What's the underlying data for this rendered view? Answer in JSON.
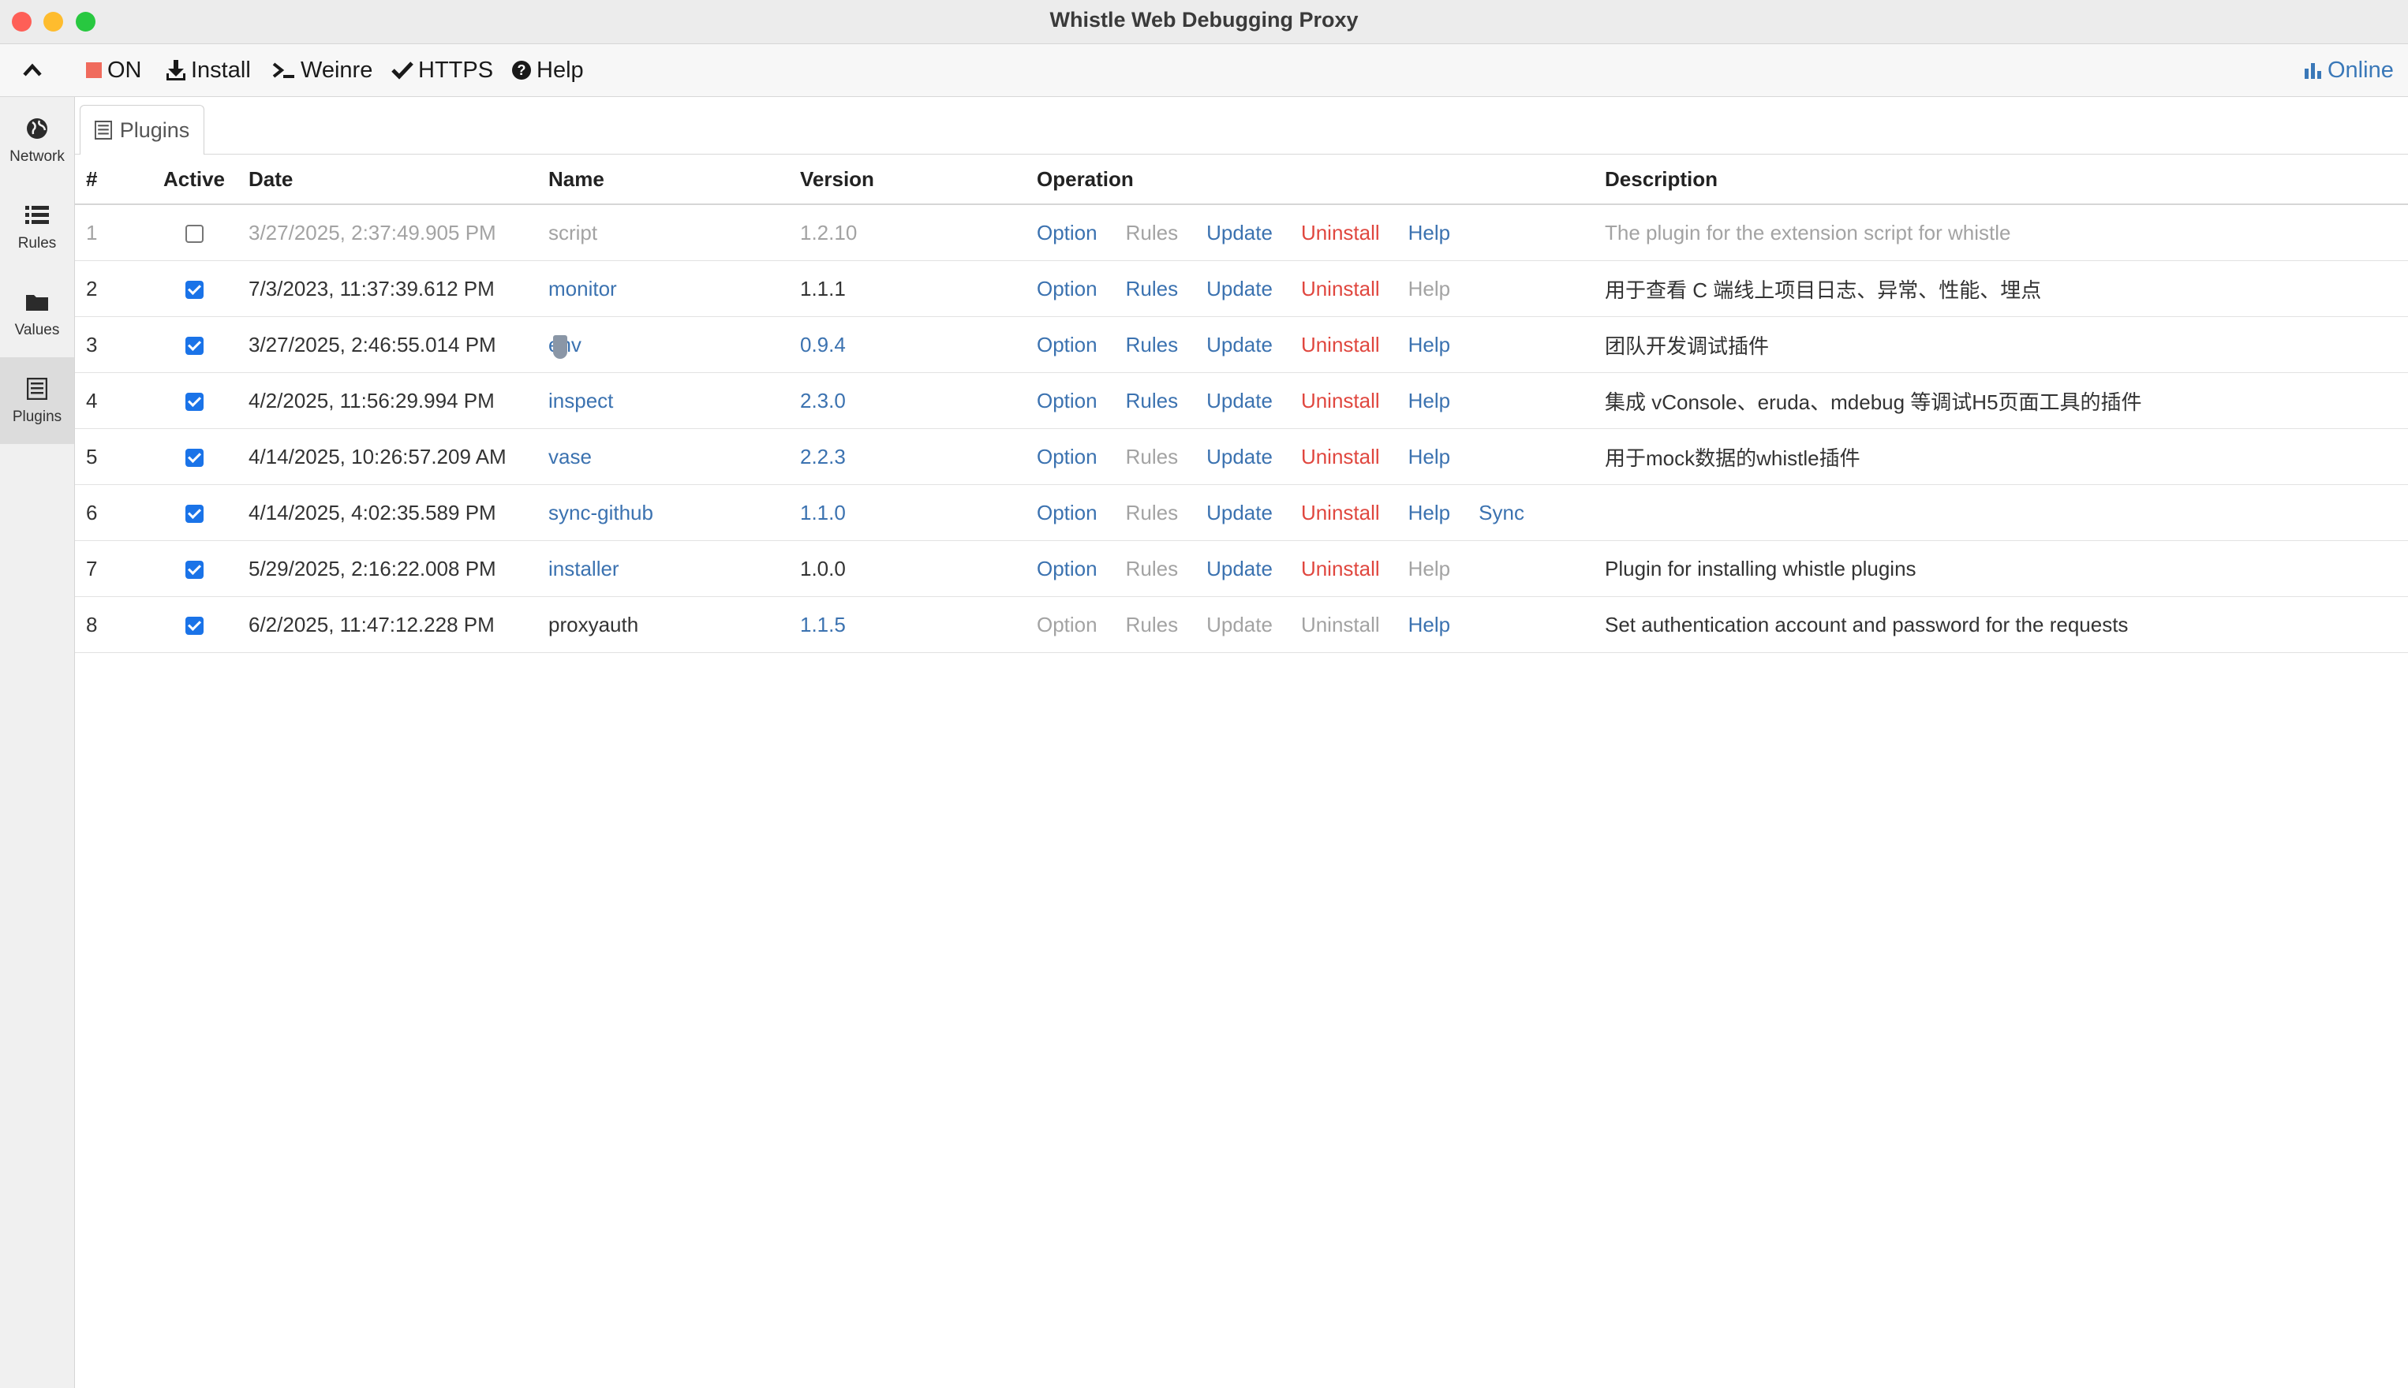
{
  "window": {
    "title": "Whistle Web Debugging Proxy"
  },
  "menubar": {
    "collapse_icon": "chevron-up-icon",
    "items": [
      {
        "label": "ON",
        "icon": "stop-square-icon",
        "color": "#f06b5d"
      },
      {
        "label": "Install",
        "icon": "download-icon"
      },
      {
        "label": "Weinre",
        "icon": "terminal-icon"
      },
      {
        "label": "HTTPS",
        "icon": "check-icon"
      },
      {
        "label": "Help",
        "icon": "question-circle-icon"
      }
    ],
    "online": {
      "label": "Online",
      "icon": "bar-chart-icon",
      "color": "#3a78b8"
    }
  },
  "sidebar": {
    "items": [
      {
        "label": "Network",
        "icon": "globe-icon",
        "active": false
      },
      {
        "label": "Rules",
        "icon": "list-icon",
        "active": false
      },
      {
        "label": "Values",
        "icon": "folder-icon",
        "active": false
      },
      {
        "label": "Plugins",
        "icon": "plugins-list-icon",
        "active": true
      }
    ]
  },
  "tab": {
    "label": "Plugins",
    "icon": "plugins-list-icon"
  },
  "table": {
    "headers": [
      "#",
      "Active",
      "Date",
      "Name",
      "Version",
      "Operation",
      "Description"
    ],
    "rows": [
      {
        "num": "1",
        "active": false,
        "disabled": true,
        "date": "3/27/2025, 2:37:49.905 PM",
        "name": "script",
        "name_link": false,
        "version": "1.2.10",
        "version_link": false,
        "ops": [
          {
            "label": "Option",
            "style": "link"
          },
          {
            "label": "Rules",
            "style": "dim"
          },
          {
            "label": "Update",
            "style": "link"
          },
          {
            "label": "Uninstall",
            "style": "red"
          },
          {
            "label": "Help",
            "style": "link"
          }
        ],
        "description": "The plugin for the extension script for whistle"
      },
      {
        "num": "2",
        "active": true,
        "disabled": false,
        "date": "7/3/2023, 11:37:39.612 PM",
        "name": "monitor",
        "name_link": true,
        "version": "1.1.1",
        "version_link": false,
        "ops": [
          {
            "label": "Option",
            "style": "link"
          },
          {
            "label": "Rules",
            "style": "link"
          },
          {
            "label": "Update",
            "style": "link"
          },
          {
            "label": "Uninstall",
            "style": "red"
          },
          {
            "label": "Help",
            "style": "dim"
          }
        ],
        "description": "用于查看 C 端线上项目日志、异常、性能、埋点"
      },
      {
        "num": "3",
        "active": true,
        "disabled": false,
        "date": "3/27/2025, 2:46:55.014 PM",
        "name": "env",
        "name_link": true,
        "version": "0.9.4",
        "version_link": true,
        "ops": [
          {
            "label": "Option",
            "style": "link"
          },
          {
            "label": "Rules",
            "style": "link"
          },
          {
            "label": "Update",
            "style": "link"
          },
          {
            "label": "Uninstall",
            "style": "red"
          },
          {
            "label": "Help",
            "style": "link"
          }
        ],
        "description": "团队开发调试插件"
      },
      {
        "num": "4",
        "active": true,
        "disabled": false,
        "date": "4/2/2025, 11:56:29.994 PM",
        "name": "inspect",
        "name_link": true,
        "version": "2.3.0",
        "version_link": true,
        "ops": [
          {
            "label": "Option",
            "style": "link"
          },
          {
            "label": "Rules",
            "style": "link"
          },
          {
            "label": "Update",
            "style": "link"
          },
          {
            "label": "Uninstall",
            "style": "red"
          },
          {
            "label": "Help",
            "style": "link"
          }
        ],
        "description": "集成 vConsole、eruda、mdebug 等调试H5页面工具的插件"
      },
      {
        "num": "5",
        "active": true,
        "disabled": false,
        "date": "4/14/2025, 10:26:57.209 AM",
        "name": "vase",
        "name_link": true,
        "version": "2.2.3",
        "version_link": true,
        "ops": [
          {
            "label": "Option",
            "style": "link"
          },
          {
            "label": "Rules",
            "style": "dim"
          },
          {
            "label": "Update",
            "style": "link"
          },
          {
            "label": "Uninstall",
            "style": "red"
          },
          {
            "label": "Help",
            "style": "link"
          }
        ],
        "description": "用于mock数据的whistle插件"
      },
      {
        "num": "6",
        "active": true,
        "disabled": false,
        "date": "4/14/2025, 4:02:35.589 PM",
        "name": "sync-github",
        "name_link": true,
        "version": "1.1.0",
        "version_link": true,
        "ops": [
          {
            "label": "Option",
            "style": "link"
          },
          {
            "label": "Rules",
            "style": "dim"
          },
          {
            "label": "Update",
            "style": "link"
          },
          {
            "label": "Uninstall",
            "style": "red"
          },
          {
            "label": "Help",
            "style": "link"
          },
          {
            "label": "Sync",
            "style": "link"
          }
        ],
        "description": ""
      },
      {
        "num": "7",
        "active": true,
        "disabled": false,
        "date": "5/29/2025, 2:16:22.008 PM",
        "name": "installer",
        "name_link": true,
        "version": "1.0.0",
        "version_link": false,
        "ops": [
          {
            "label": "Option",
            "style": "link"
          },
          {
            "label": "Rules",
            "style": "dim"
          },
          {
            "label": "Update",
            "style": "link"
          },
          {
            "label": "Uninstall",
            "style": "red"
          },
          {
            "label": "Help",
            "style": "dim"
          }
        ],
        "description": "Plugin for installing whistle plugins"
      },
      {
        "num": "8",
        "active": true,
        "disabled": false,
        "date": "6/2/2025, 11:47:12.228 PM",
        "name": "proxyauth",
        "name_link": false,
        "version": "1.1.5",
        "version_link": true,
        "ops": [
          {
            "label": "Option",
            "style": "dim"
          },
          {
            "label": "Rules",
            "style": "dim"
          },
          {
            "label": "Update",
            "style": "dim"
          },
          {
            "label": "Uninstall",
            "style": "dim"
          },
          {
            "label": "Help",
            "style": "link"
          }
        ],
        "description": "Set authentication account and password for the requests"
      }
    ]
  },
  "colors": {
    "link": "#3b72b0",
    "danger": "#e0473f",
    "muted": "#a3a3a3",
    "checkbox": "#1a73e8"
  }
}
